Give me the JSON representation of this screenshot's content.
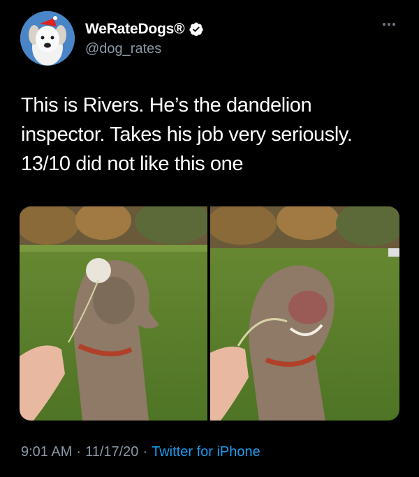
{
  "author": {
    "display_name": "WeRateDogs®",
    "handle": "@dog_rates",
    "verified_icon": "verified-badge-icon",
    "avatar_icon": "dog-avatar"
  },
  "tweet": {
    "lines": [
      "This is Rivers. He’s the dandelion",
      "inspector. Takes his job very seriously.",
      "13/10 did not like this one"
    ]
  },
  "media": {
    "images": [
      "dog-sniffing-dandelion-photo",
      "dog-smiling-after-dandelion-photo"
    ]
  },
  "meta": {
    "time": "9:01 AM",
    "date": "11/17/20",
    "source": "Twitter for iPhone",
    "separator": "·"
  },
  "colors": {
    "background": "#000000",
    "secondary_text": "#8b98a5",
    "link": "#1d9bf0",
    "verified_badge": "#ffffff"
  }
}
